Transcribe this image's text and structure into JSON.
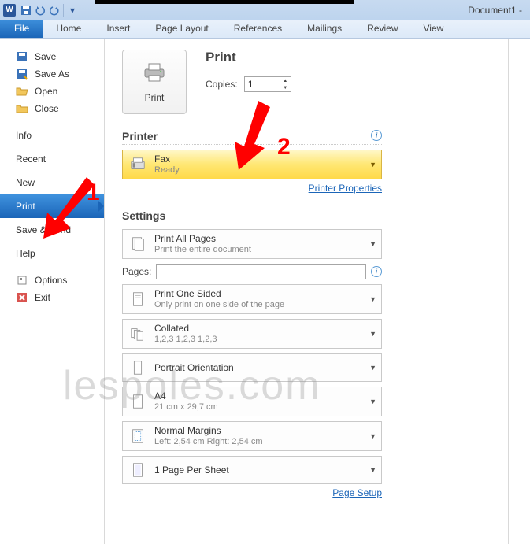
{
  "titlebar": {
    "app_letter": "W",
    "doc_title": "Document1 -"
  },
  "ribbon": {
    "file": "File",
    "tabs": [
      "Home",
      "Insert",
      "Page Layout",
      "References",
      "Mailings",
      "Review",
      "View"
    ]
  },
  "sidebar": {
    "save": "Save",
    "save_as": "Save As",
    "open": "Open",
    "close": "Close",
    "info": "Info",
    "recent": "Recent",
    "new": "New",
    "print": "Print",
    "save_send": "Save & Send",
    "help": "Help",
    "options": "Options",
    "exit": "Exit"
  },
  "print": {
    "button_label": "Print",
    "title": "Print",
    "copies_label": "Copies:",
    "copies_value": "1"
  },
  "printer": {
    "section": "Printer",
    "name": "Fax",
    "status": "Ready",
    "properties": "Printer Properties"
  },
  "settings": {
    "section": "Settings",
    "pages_label": "Pages:",
    "pages_value": "",
    "items": [
      {
        "t1": "Print All Pages",
        "t2": "Print the entire document"
      },
      {
        "t1": "Print One Sided",
        "t2": "Only print on one side of the page"
      },
      {
        "t1": "Collated",
        "t2": "1,2,3   1,2,3   1,2,3"
      },
      {
        "t1": "Portrait Orientation",
        "t2": ""
      },
      {
        "t1": "A4",
        "t2": "21 cm x 29,7 cm"
      },
      {
        "t1": "Normal Margins",
        "t2": "Left:  2,54 cm    Right:  2,54 cm"
      },
      {
        "t1": "1 Page Per Sheet",
        "t2": ""
      }
    ],
    "page_setup": "Page Setup"
  },
  "annotations": {
    "one": "1",
    "two": "2"
  },
  "watermark": "lespoles.com"
}
